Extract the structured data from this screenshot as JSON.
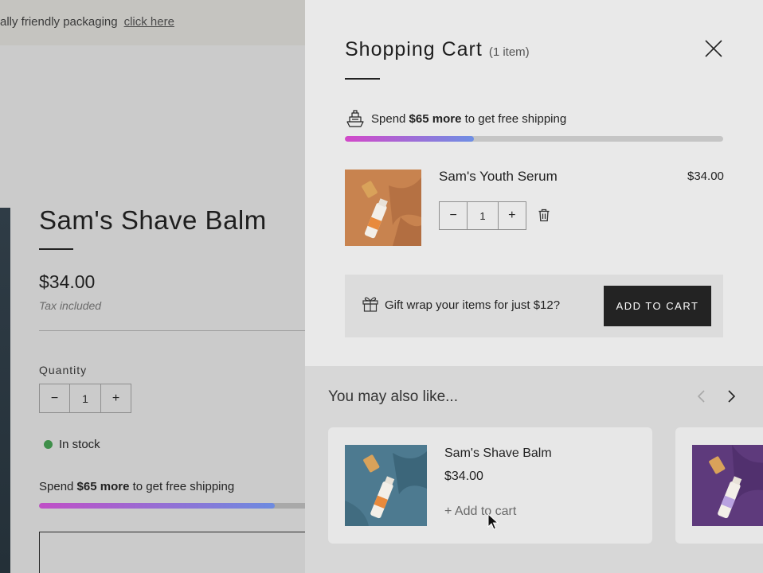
{
  "background_page": {
    "announcement": {
      "text": "ally friendly packaging",
      "link": "click here"
    },
    "product": {
      "title": "Sam's Shave Balm",
      "price": "$34.00",
      "tax_note": "Tax included",
      "quantity_label": "Quantity",
      "quantity_minus": "−",
      "quantity_value": "1",
      "quantity_plus": "+",
      "stock_status": "In stock",
      "shipping_prefix": "Spend ",
      "shipping_amount": "$65 more",
      "shipping_suffix": " to get free shipping",
      "shipping_progress": 0.87
    }
  },
  "cart": {
    "title": "Shopping Cart",
    "count": "(1 item)",
    "close_icon": "close-icon",
    "shipping": {
      "icon": "ship-icon",
      "prefix": "Spend ",
      "amount": "$65 more",
      "suffix": " to get free shipping",
      "progress": 0.34
    },
    "items": [
      {
        "name": "Sam's Youth Serum",
        "price": "$34.00",
        "qty_minus": "−",
        "qty": "1",
        "qty_plus": "+",
        "remove_icon": "trash-icon"
      }
    ],
    "gift_wrap": {
      "icon": "gift-icon",
      "text": "Gift wrap your items for just $12?",
      "button": "ADD TO CART"
    },
    "recommendations": {
      "title": "You may also like...",
      "prev_icon": "chevron-left-icon",
      "next_icon": "chevron-right-icon",
      "products": [
        {
          "name": "Sam's Shave Balm",
          "price": "$34.00",
          "add_label": "+ Add to cart"
        }
      ]
    }
  },
  "colors": {
    "accent_gradient_start": "#d348c9",
    "accent_gradient_end": "#6e8fe4",
    "button_dark": "#232323",
    "in_stock_green": "#3f8f4a"
  }
}
